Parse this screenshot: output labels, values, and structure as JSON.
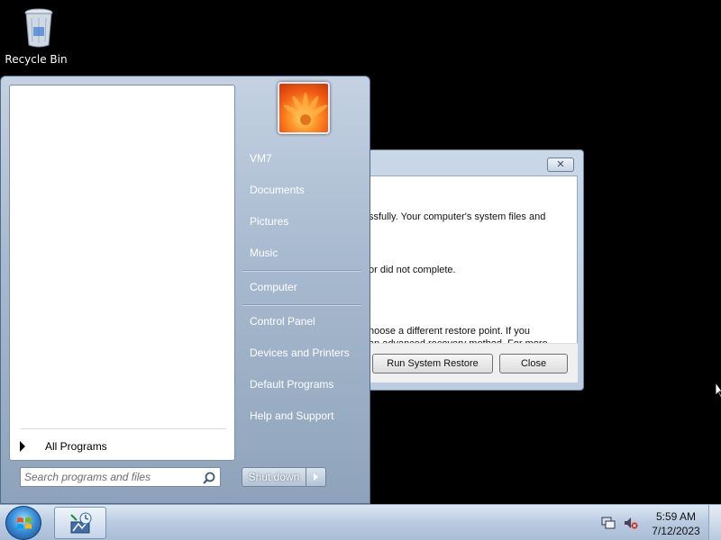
{
  "desktop": {
    "recycle_bin_label": "Recycle Bin"
  },
  "dialog": {
    "close_glyph": "✕",
    "line1": "ssfully. Your computer's system files and",
    "line2": "or did not complete.",
    "line3": "hoose a different restore point.  If you",
    "line4": "an advanced recovery method. For more",
    "run_button": "Run System Restore",
    "close_button": "Close"
  },
  "start_menu": {
    "all_programs": "All Programs",
    "search_placeholder": "Search programs and files",
    "right_items": [
      {
        "label": "VM7"
      },
      {
        "label": "Documents"
      },
      {
        "label": "Pictures"
      },
      {
        "label": "Music"
      },
      {
        "label": "Computer"
      },
      {
        "label": "Control Panel"
      },
      {
        "label": "Devices and Printers"
      },
      {
        "label": "Default Programs"
      },
      {
        "label": "Help and Support"
      }
    ],
    "shutdown_label": "Shut down"
  },
  "taskbar": {
    "time": "5:59 AM",
    "date": "7/12/2023"
  },
  "icons": {
    "recycle_bin": "recycle-bin-icon",
    "start_orb": "windows-logo-icon",
    "search": "search-icon",
    "network": "network-icon",
    "volume_muted": "volume-muted-icon",
    "system_restore": "system-restore-icon"
  }
}
